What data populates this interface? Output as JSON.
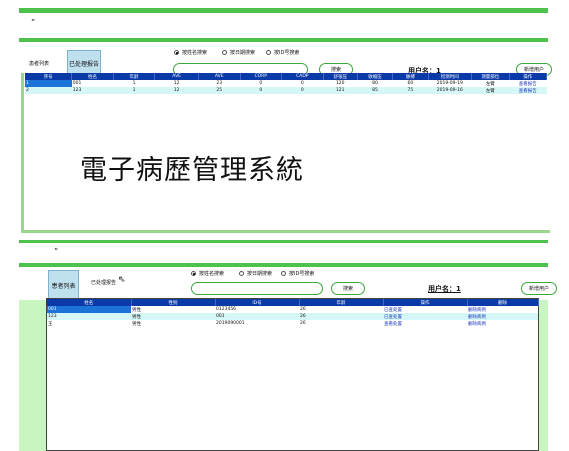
{
  "window1": {
    "title_mark": "ˮ",
    "sidebar": {
      "view_label": "患者列表",
      "processed_button": "已处理报告"
    },
    "search": {
      "options": [
        {
          "label": "按姓名搜索",
          "selected": true
        },
        {
          "label": "按日期搜索",
          "selected": false
        },
        {
          "label": "按ID号搜索",
          "selected": false
        }
      ],
      "input_value": "",
      "button": "搜索"
    },
    "user_label": "用户名：1",
    "new_user_button": "新增用户",
    "table": {
      "columns": [
        "序号",
        "姓名",
        "年龄",
        "AVE",
        "AVE",
        "CORP",
        "CADP",
        "舒张压",
        "收缩压",
        "脉搏",
        "检测时间",
        "测量部位",
        "操作"
      ],
      "rows": [
        [
          "1",
          "001",
          "1",
          "12",
          "23",
          "0",
          "0",
          "120",
          "80",
          "60",
          "2019-09-19",
          "左臂",
          "查看报告"
        ],
        [
          "2",
          "123",
          "1",
          "12",
          "25",
          "0",
          "0",
          "121",
          "85",
          "75",
          "2019-09-16",
          "左臂",
          "查看报告"
        ]
      ]
    },
    "banner": "電子病歷管理系統"
  },
  "window2": {
    "title_mark": "ˮ",
    "sidebar": {
      "patient_button": "患者列表",
      "processed_label": "已处理报告"
    },
    "search": {
      "options": [
        {
          "label": "按姓名搜索",
          "selected": true
        },
        {
          "label": "按日期搜索",
          "selected": false
        },
        {
          "label": "按ID号搜索",
          "selected": false
        }
      ],
      "input_value": "",
      "button": "搜索"
    },
    "user_label": "用户名：1",
    "new_user_button": "新增用户",
    "table": {
      "columns": [
        "姓名",
        "性别",
        "ID号",
        "年龄",
        "操作",
        "删除"
      ],
      "rows": [
        [
          "001",
          "男性",
          "0123456",
          "26",
          "已查处置",
          "删除病例"
        ],
        [
          "123",
          "男性",
          "001",
          "26",
          "已查处置",
          "删除病例"
        ],
        [
          "王",
          "男性",
          "2019090001",
          "26",
          "查看处置",
          "删除病例"
        ]
      ]
    }
  },
  "colors": {
    "green": "#4dc34d",
    "light_green": "#c9f5c0",
    "header_blue": "#0a3aa8",
    "row_alt": "#d6f7f7",
    "select_blue": "#1c74d9"
  }
}
